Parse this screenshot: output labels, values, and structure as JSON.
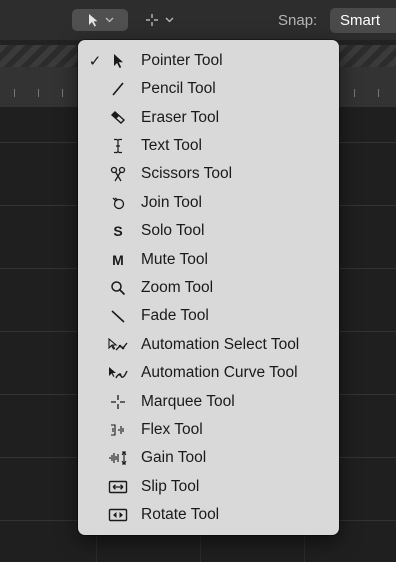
{
  "toolbar": {
    "left_tool_icon": "pointer-arrow-icon",
    "right_tool_icon": "marquee-crosshair-icon",
    "snap_label": "Snap:",
    "snap_value": "Smart"
  },
  "menu": {
    "items": [
      {
        "label": "Pointer Tool",
        "icon": "pointer-icon",
        "checked": true
      },
      {
        "label": "Pencil Tool",
        "icon": "pencil-icon",
        "checked": false
      },
      {
        "label": "Eraser Tool",
        "icon": "eraser-icon",
        "checked": false
      },
      {
        "label": "Text Tool",
        "icon": "text-cursor-icon",
        "checked": false
      },
      {
        "label": "Scissors Tool",
        "icon": "scissors-icon",
        "checked": false
      },
      {
        "label": "Join Tool",
        "icon": "join-icon",
        "checked": false
      },
      {
        "label": "Solo Tool",
        "icon": "solo-icon",
        "glyph": "S",
        "checked": false
      },
      {
        "label": "Mute Tool",
        "icon": "mute-icon",
        "glyph": "M",
        "checked": false
      },
      {
        "label": "Zoom Tool",
        "icon": "magnifier-icon",
        "checked": false
      },
      {
        "label": "Fade Tool",
        "icon": "fade-icon",
        "checked": false
      },
      {
        "label": "Automation Select Tool",
        "icon": "automation-select-icon",
        "checked": false
      },
      {
        "label": "Automation Curve Tool",
        "icon": "automation-curve-icon",
        "checked": false
      },
      {
        "label": "Marquee Tool",
        "icon": "marquee-icon",
        "checked": false
      },
      {
        "label": "Flex Tool",
        "icon": "flex-icon",
        "checked": false
      },
      {
        "label": "Gain Tool",
        "icon": "gain-icon",
        "checked": false
      },
      {
        "label": "Slip Tool",
        "icon": "slip-icon",
        "checked": false
      },
      {
        "label": "Rotate Tool",
        "icon": "rotate-icon",
        "checked": false
      }
    ],
    "check_glyph": "✓"
  },
  "colors": {
    "menu_background": "#d9d9d9",
    "menu_text": "#1a1a1a",
    "toolbar_background": "#2d2d2d",
    "workspace_background": "#1f1f1f"
  }
}
